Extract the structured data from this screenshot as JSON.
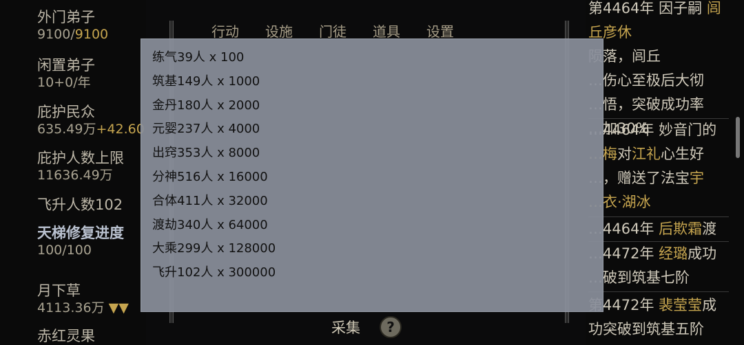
{
  "left_stats": [
    {
      "label": "外门弟子",
      "value_main": "9100/",
      "value_extra": "9100"
    },
    {
      "label": "闲置弟子",
      "value_main": "10+",
      "value_extra": "0/年"
    },
    {
      "label": "庇护民众",
      "value_main": "635.49万",
      "value_extra": "+42.60"
    },
    {
      "label": "庇护人数上限",
      "value_main": "",
      "value_extra": "11636.49万"
    },
    {
      "label": "飞升人数102",
      "value_main": "",
      "value_extra": ""
    },
    {
      "label": "天梯修复进度",
      "value_main": "100/100",
      "value_extra": ""
    },
    {
      "label": "月下草",
      "value_main": "4113.36万",
      "value_extra": "▼▼"
    },
    {
      "label": "赤红灵果",
      "value_main": "",
      "value_extra": ""
    }
  ],
  "nav": {
    "items": [
      "行动",
      "设施",
      "门徒",
      "道具",
      "设置"
    ]
  },
  "bottom": {
    "collect_label": "采集",
    "help_glyph": "?"
  },
  "log_entries": [
    {
      "parts": [
        "第4464年 因子嗣 ",
        "闾丘彦休",
        "陨落，闾丘",
        "…伤心至极后大彻",
        "…悟，突破成功率",
        "…加30%"
      ]
    },
    {
      "parts": [
        "…4464年 妙音门的",
        "…梅",
        "对",
        "江礼",
        "心生好",
        "…，赠送了法宝",
        "宇",
        "…衣·湖冰"
      ]
    },
    {
      "parts": [
        "…4464年 ",
        "后欺霜",
        "渡"
      ]
    },
    {
      "parts": [
        "…4472年 ",
        "经璐",
        "成功",
        "…破到筑基七阶"
      ]
    },
    {
      "parts": [
        "第4472年 ",
        "裴莹莹",
        "成",
        "功突破到筑基五阶"
      ]
    }
  ],
  "modal": {
    "rows": [
      "练气39人 x 100",
      "筑基149人 x 1000",
      "金丹180人 x 2000",
      "元婴237人 x 4000",
      "出窍353人 x 8000",
      "分神516人 x 16000",
      "合体411人 x 32000",
      "渡劫340人 x 64000",
      "大乘299人 x 128000",
      "飞升102人 x 300000"
    ]
  }
}
